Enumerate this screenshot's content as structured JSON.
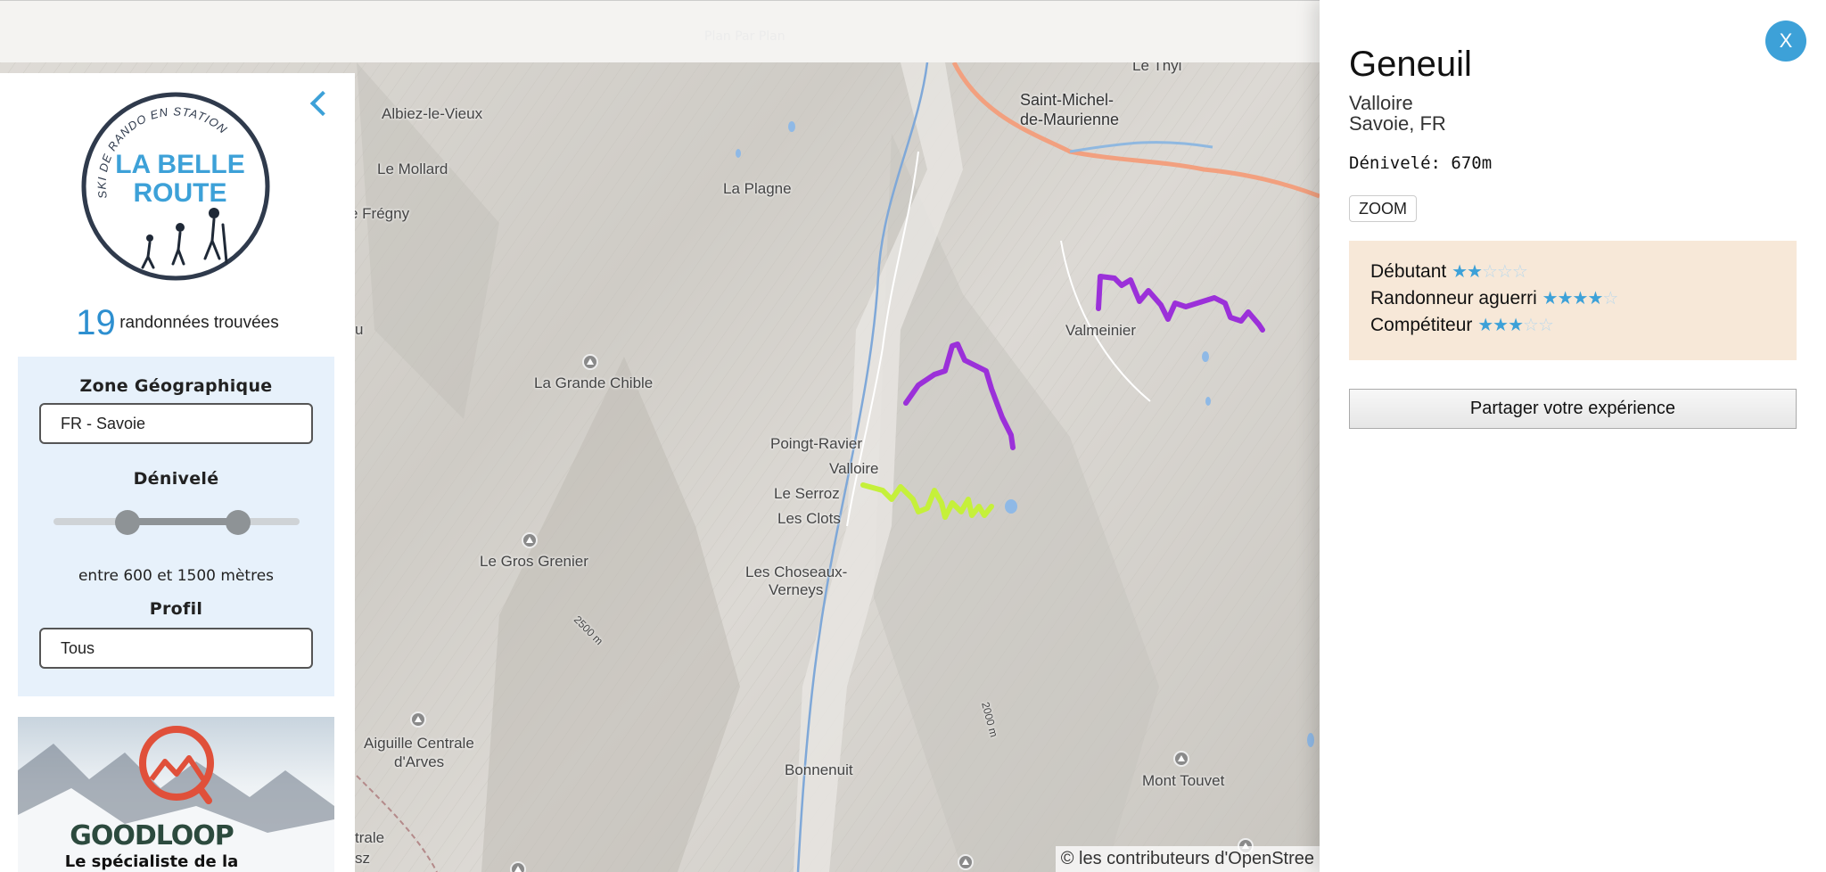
{
  "topbar": {
    "ghost_text": "Plan Par Plan"
  },
  "map": {
    "labels": {
      "le_thyl": "Le Thyl",
      "saint_michel_1": "Saint-Michel-",
      "saint_michel_2": "de-Maurienne",
      "albiez": "Albiez-le-Vieux",
      "le_mollard": "Le Mollard",
      "la_plagne": "La Plagne",
      "fregny": "e Frégny",
      "valmeinier": "Valmeinier",
      "la_grande_chible": "La Grande Chible",
      "poingt_ravier": "Poingt-Ravier",
      "valloire": "Valloire",
      "le_serroz": "Le Serroz",
      "les_clots": "Les Clots",
      "le_gros_grenier": "Le Gros Grenier",
      "choseaux_1": "Les Choseaux-",
      "choseaux_2": "Verneys",
      "contour_2500": "2500 m",
      "contour_2000": "2000 m",
      "aiguille_1": "Aiguille Centrale",
      "aiguille_2": "d'Arves",
      "bonnenuit": "Bonnenuit",
      "mont_touvet": "Mont Touvet",
      "edge_u": "u",
      "edge_trale": "trale",
      "edge_sz": "sz"
    },
    "trail_colors": {
      "trail_1": "#9b30d9",
      "trail_2": "#9b30d9",
      "trail_3": "#c5f03a"
    },
    "attribution": "© les contributeurs d'OpenStree"
  },
  "sidebar": {
    "logo": {
      "arc_text": "SKI DE RANDO EN STATION",
      "line1": "LA BELLE",
      "line2": "ROUTE"
    },
    "count": "19",
    "count_label": "randonnées trouvées",
    "filters": {
      "zone_title": "Zone Géographique",
      "zone_value": "FR - Savoie",
      "elevation_title": "Dénivelé",
      "elevation_min_fraction": 0.3,
      "elevation_max_fraction": 0.75,
      "elevation_range_text": "entre 600 et 1500 mètres",
      "profile_title": "Profil",
      "profile_value": "Tous"
    },
    "ad": {
      "brand": "GOODLOOP",
      "tagline": "Le spécialiste de la"
    }
  },
  "panel": {
    "close_label": "X",
    "title": "Geneuil",
    "location_line1": "Valloire",
    "location_line2": "Savoie, FR",
    "elevation": "Dénivelé: 670m",
    "zoom_label": "ZOOM",
    "levels": [
      {
        "label": "Débutant",
        "stars": 2,
        "max": 5
      },
      {
        "label": "Randonneur aguerri",
        "stars": 4,
        "max": 5
      },
      {
        "label": "Compétiteur",
        "stars": 3,
        "max": 5
      }
    ],
    "share_label": "Partager votre expérience"
  },
  "colors": {
    "accent": "#3da1d8",
    "filter_bg": "#e7f1fb",
    "levels_bg": "#f7e8d8"
  },
  "icons": [
    "chevron-left-icon",
    "peak-icon",
    "close-icon",
    "star-icon",
    "hiker-icon"
  ]
}
